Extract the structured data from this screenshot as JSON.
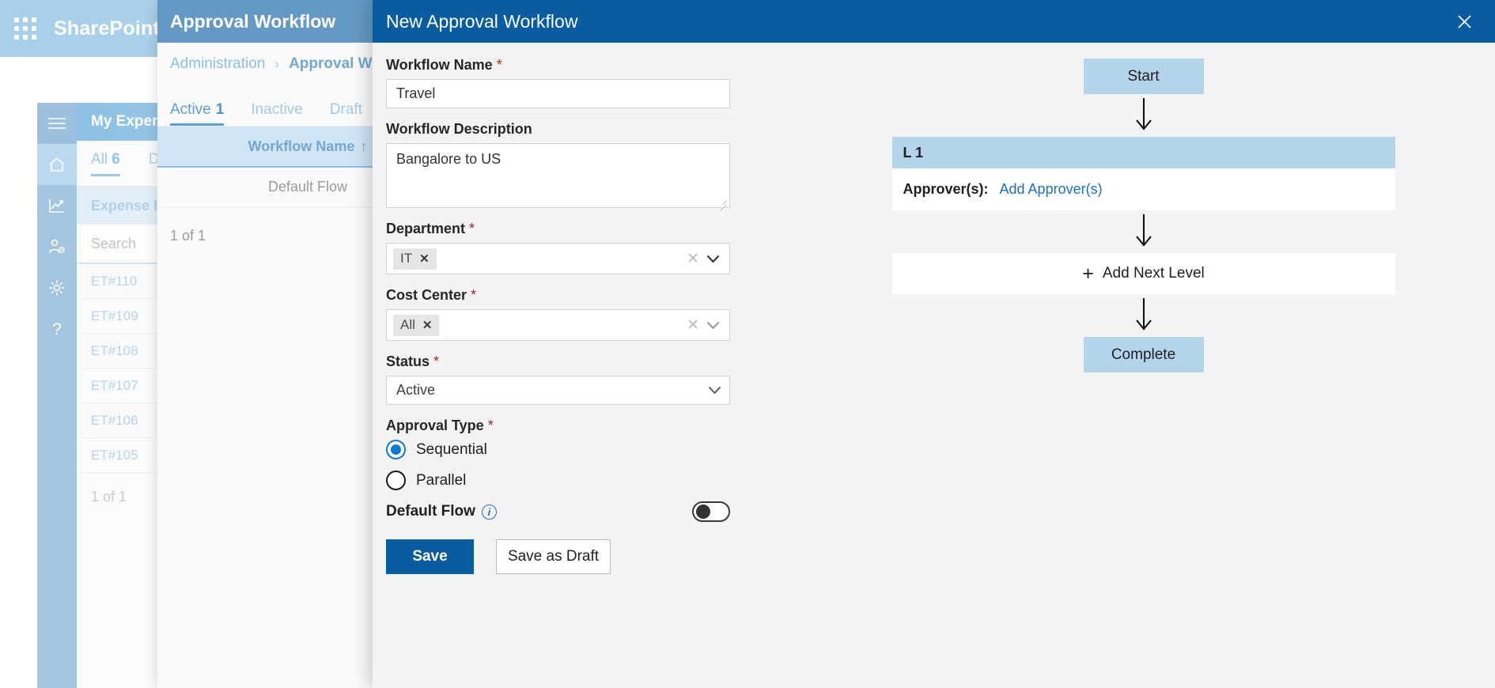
{
  "shell": {
    "brand": "SharePoint",
    "waffle_icon": "app-launcher-icon",
    "rail": [
      {
        "name": "menu-icon",
        "label": "Menu"
      },
      {
        "name": "home-icon",
        "label": "Home"
      },
      {
        "name": "analytics-icon",
        "label": "Analytics"
      },
      {
        "name": "user-settings-icon",
        "label": "User Settings"
      },
      {
        "name": "gear-icon",
        "label": "Settings"
      },
      {
        "name": "help-icon",
        "label": "Help"
      }
    ]
  },
  "background_panel": {
    "title": "My Expenses",
    "tabs": [
      {
        "label": "All",
        "count": "6",
        "selected": true
      },
      {
        "label": "Draft",
        "count": "",
        "selected": false
      }
    ],
    "column_header": "Expense ID",
    "sort_arrow": "↑",
    "search_placeholder": "Search",
    "rows": [
      "ET#110",
      "ET#109",
      "ET#108",
      "ET#107",
      "ET#106",
      "ET#105"
    ],
    "footer": "1 of 1"
  },
  "middle_panel": {
    "header_title": "Approval Workflow",
    "breadcrumb": {
      "parent": "Administration",
      "separator": "›",
      "current": "Approval Wor"
    },
    "tabs": [
      {
        "label": "Active",
        "count": "1",
        "selected": true
      },
      {
        "label": "Inactive",
        "count": "",
        "selected": false
      },
      {
        "label": "Draft",
        "count": "",
        "selected": false
      }
    ],
    "column_header": "Workflow Name",
    "sort_arrow": "↑",
    "rows": [
      "Default Flow"
    ],
    "footer": "1 of 1"
  },
  "modal": {
    "title": "New Approval Workflow",
    "close_icon": "close-icon",
    "accent_color": "#0a5ca0",
    "required_marker": "*",
    "fields": {
      "workflow_name": {
        "label": "Workflow Name",
        "required": true,
        "value": "Travel"
      },
      "workflow_description": {
        "label": "Workflow Description",
        "required": false,
        "value": "Bangalore to US"
      },
      "department": {
        "label": "Department",
        "required": true,
        "chips": [
          "IT"
        ],
        "chip_remove": "✕",
        "clear_icon": "clear-icon",
        "chevron_icon": "chevron-down-icon"
      },
      "cost_center": {
        "label": "Cost Center",
        "required": true,
        "chips": [
          "All"
        ],
        "chip_remove": "✕",
        "clear_icon": "clear-icon",
        "chevron_icon": "chevron-down-icon"
      },
      "status": {
        "label": "Status",
        "required": true,
        "value": "Active",
        "chevron_icon": "chevron-down-icon"
      },
      "approval_type": {
        "label": "Approval Type",
        "required": true,
        "options": [
          {
            "label": "Sequential",
            "selected": true
          },
          {
            "label": "Parallel",
            "selected": false
          }
        ]
      },
      "default_flow": {
        "label": "Default Flow",
        "info_icon": "info-icon",
        "toggle_on": false
      }
    },
    "buttons": {
      "save": "Save",
      "save_as_draft": "Save as Draft"
    }
  },
  "diagram": {
    "start_label": "Start",
    "level": {
      "title": "L 1",
      "approvers_label": "Approver(s):",
      "add_approvers_link": "Add Approver(s)"
    },
    "add_next_level": "Add Next Level",
    "plus_icon": "plus-icon",
    "complete_label": "Complete",
    "arrow_icon": "arrow-down-icon"
  }
}
